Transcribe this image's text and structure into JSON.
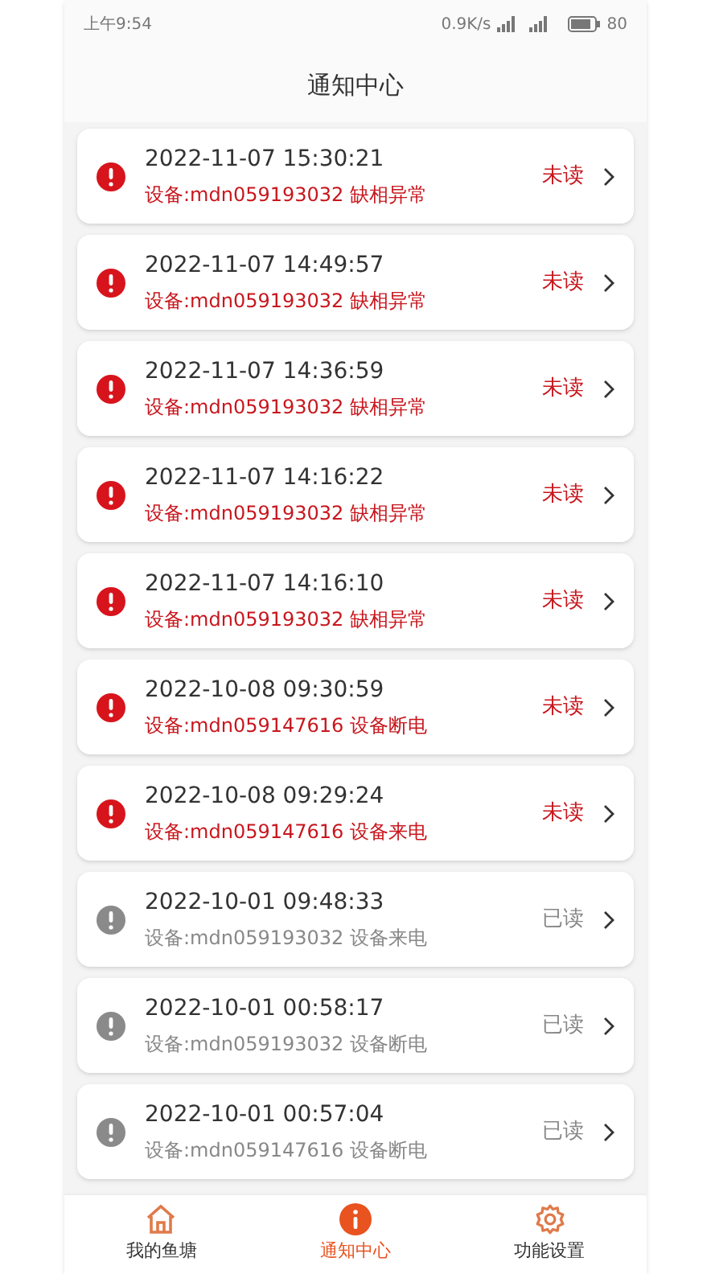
{
  "status_bar": {
    "time": "上午9:54",
    "speed": "0.9K/s",
    "battery": "80"
  },
  "header": {
    "title": "通知中心"
  },
  "notifications": [
    {
      "time": "2022-11-07 15:30:21",
      "message": "设备:mdn059193032 缺相异常",
      "status": "未读",
      "read": false
    },
    {
      "time": "2022-11-07 14:49:57",
      "message": "设备:mdn059193032 缺相异常",
      "status": "未读",
      "read": false
    },
    {
      "time": "2022-11-07 14:36:59",
      "message": "设备:mdn059193032 缺相异常",
      "status": "未读",
      "read": false
    },
    {
      "time": "2022-11-07 14:16:22",
      "message": "设备:mdn059193032 缺相异常",
      "status": "未读",
      "read": false
    },
    {
      "time": "2022-11-07 14:16:10",
      "message": "设备:mdn059193032 缺相异常",
      "status": "未读",
      "read": false
    },
    {
      "time": "2022-10-08 09:30:59",
      "message": "设备:mdn059147616 设备断电",
      "status": "未读",
      "read": false
    },
    {
      "time": "2022-10-08 09:29:24",
      "message": "设备:mdn059147616 设备来电",
      "status": "未读",
      "read": false
    },
    {
      "time": "2022-10-01 09:48:33",
      "message": "设备:mdn059193032 设备来电",
      "status": "已读",
      "read": true
    },
    {
      "time": "2022-10-01 00:58:17",
      "message": "设备:mdn059193032 设备断电",
      "status": "已读",
      "read": true
    },
    {
      "time": "2022-10-01 00:57:04",
      "message": "设备:mdn059147616 设备断电",
      "status": "已读",
      "read": true
    }
  ],
  "tab_bar": [
    {
      "label": "我的鱼塘",
      "kind": "home",
      "selected": false
    },
    {
      "label": "通知中心",
      "kind": "notice",
      "selected": true
    },
    {
      "label": "功能设置",
      "kind": "settings",
      "selected": false
    }
  ]
}
